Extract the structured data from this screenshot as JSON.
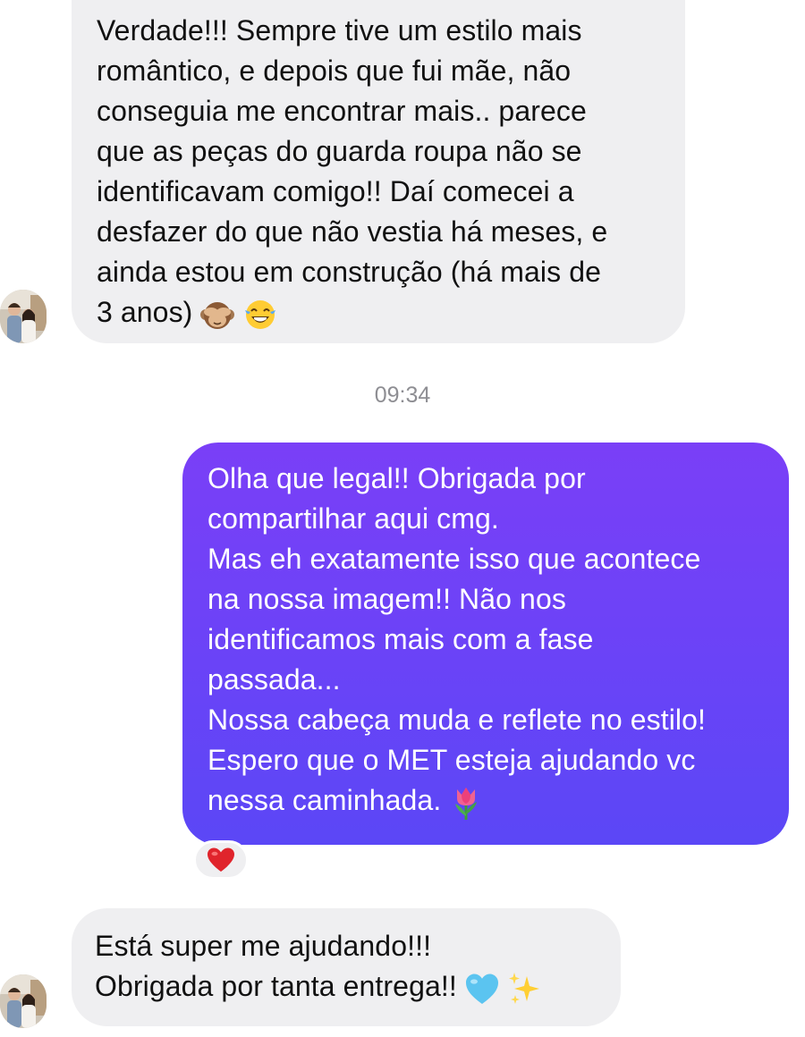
{
  "conversation": {
    "messages": [
      {
        "direction": "incoming",
        "lines": [
          "Verdade!!! Sempre tive um estilo mais",
          "romântico, e depois que fui mãe, não",
          "conseguia me encontrar mais.. parece",
          "que as peças do guarda roupa não se",
          "identificavam comigo!! Daí comecei a",
          "desfazer do que não vestia há meses, e",
          "ainda estou em construção (há mais de",
          "3 anos)"
        ],
        "emojis": [
          "see-no-evil-monkey-icon",
          "tears-of-joy-icon"
        ]
      },
      {
        "direction": "outgoing",
        "lines": [
          "Olha que legal!! Obrigada por",
          "compartilhar aqui cmg.",
          "Mas eh exatamente isso que acontece",
          "na nossa imagem!! Não nos",
          "identificamos mais com a fase",
          "passada...",
          "Nossa cabeça muda e reflete no estilo!",
          "Espero que o MET esteja ajudando vc",
          "nessa caminhada."
        ],
        "emojis": [
          "tulip-icon"
        ],
        "reaction": "red-heart-icon"
      },
      {
        "direction": "incoming",
        "lines": [
          "Está super me ajudando!!!",
          "Obrigada por tanta entrega!!"
        ],
        "emojis": [
          "blue-heart-icon",
          "sparkles-icon"
        ]
      }
    ],
    "timestamp": "09:34"
  },
  "colors": {
    "incoming_bubble": "#efeff1",
    "outgoing_bubble_top": "#7a3ff7",
    "outgoing_bubble_bottom": "#5b47f6",
    "timestamp_text": "#8e8e93"
  }
}
